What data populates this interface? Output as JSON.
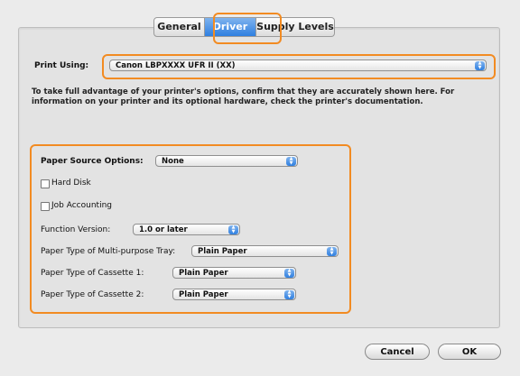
{
  "tabs": [
    "General",
    "Driver",
    "Supply Levels"
  ],
  "active_tab": "Driver",
  "print_using": {
    "label": "Print Using:",
    "value": "Canon LBPXXXX UFR II (XX)"
  },
  "description": "To take full advantage of your printer's options, confirm that they are accurately shown here. For information on your printer and its optional hardware, check the printer's documentation.",
  "options": {
    "paper_source": {
      "label": "Paper Source Options:",
      "value": "None"
    },
    "hard_disk": {
      "label": "Hard Disk",
      "checked": false
    },
    "job_accounting": {
      "label": "Job Accounting",
      "checked": false
    },
    "function_version": {
      "label": "Function Version:",
      "value": "1.0 or later"
    },
    "mp_tray": {
      "label": "Paper Type of Multi-purpose Tray:",
      "value": "Plain Paper"
    },
    "cassette1": {
      "label": "Paper Type of Cassette 1:",
      "value": "Plain Paper"
    },
    "cassette2": {
      "label": "Paper Type of Cassette 2:",
      "value": "Plain Paper"
    }
  },
  "buttons": {
    "cancel": "Cancel",
    "ok": "OK"
  },
  "colors": {
    "highlight": "#f28b22",
    "accent_blue": "#2f7fe0",
    "panel": "#e3e3e3"
  },
  "icons": {
    "popup_arrows": "up-down-arrows-icon"
  }
}
